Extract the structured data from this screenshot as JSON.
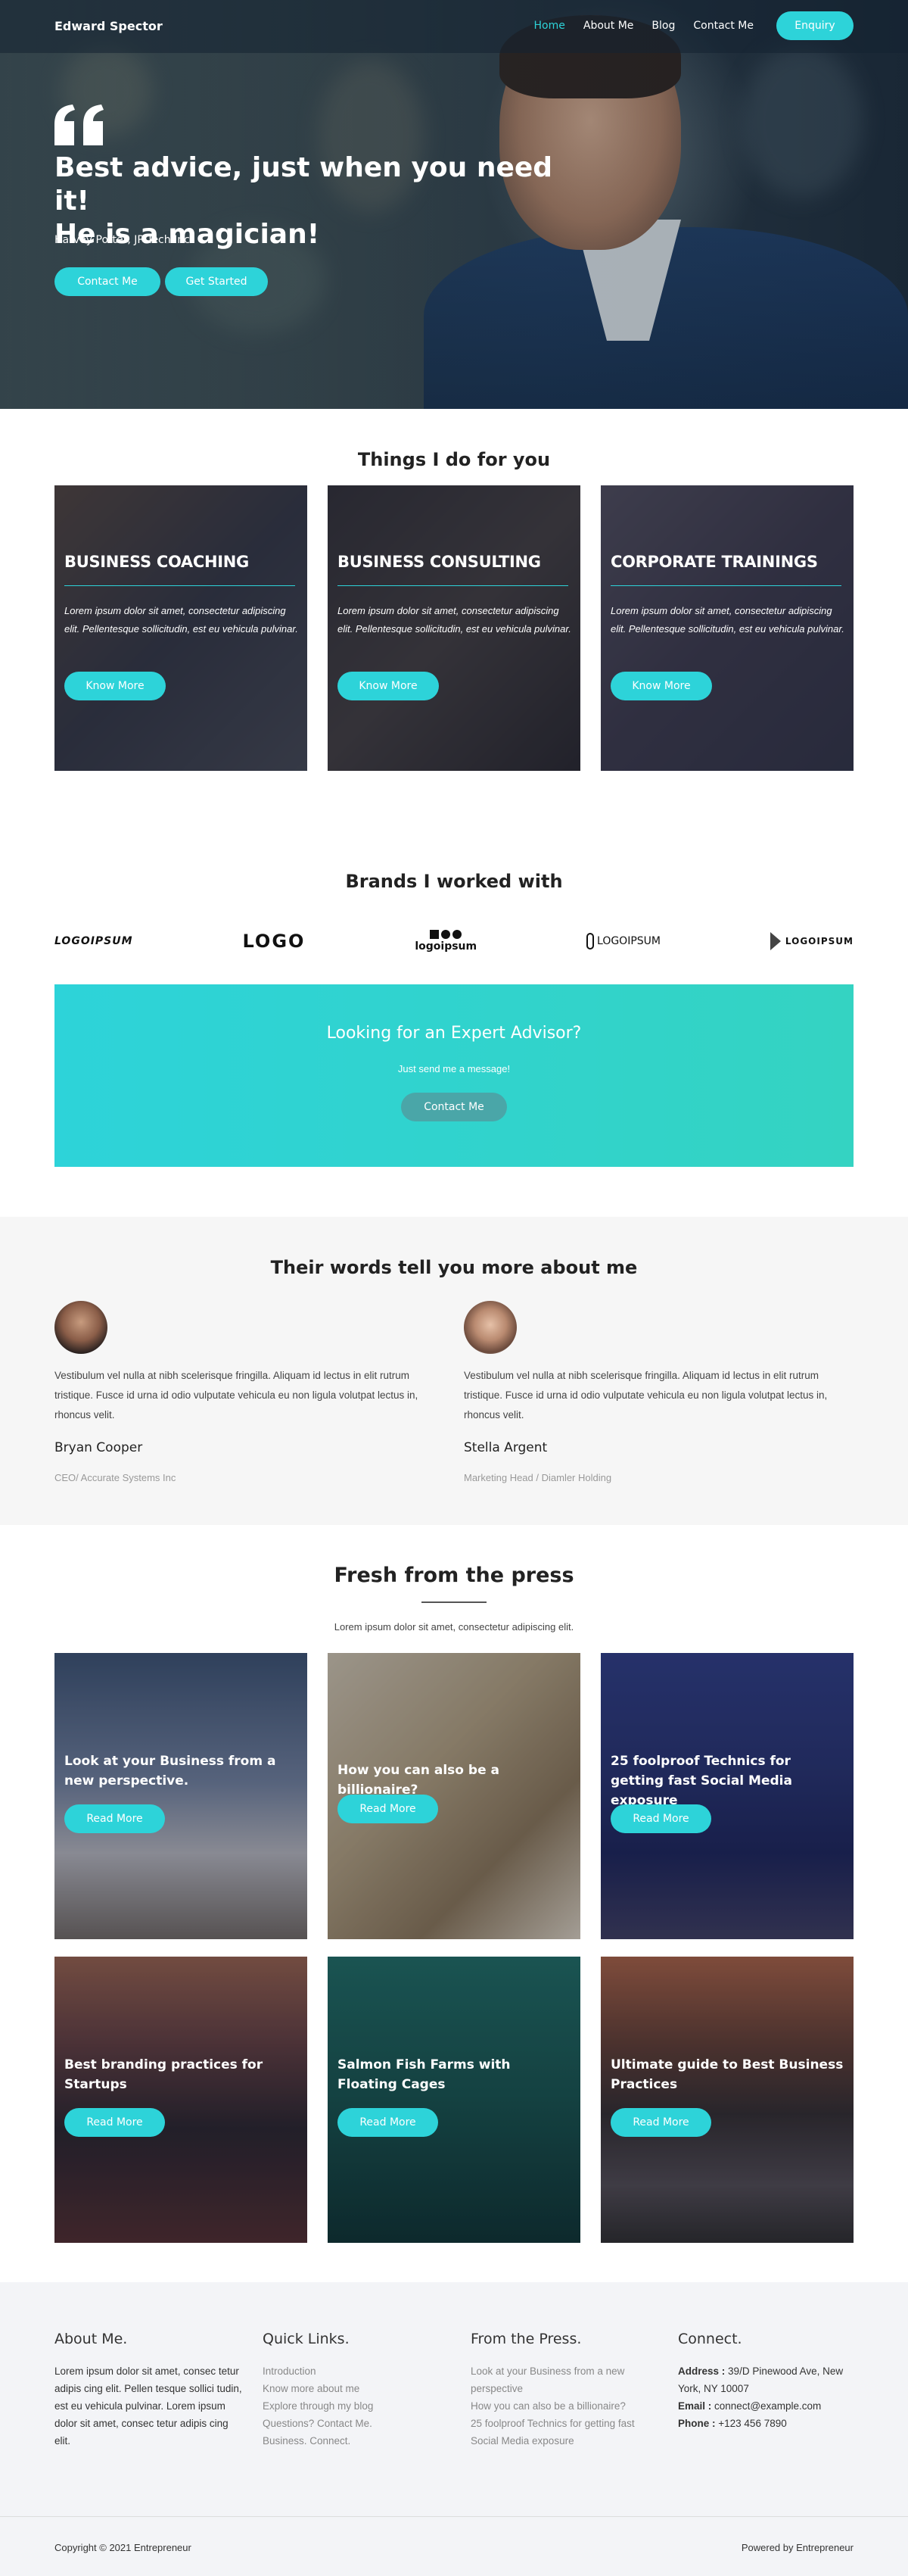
{
  "nav": {
    "brand": "Edward Spector",
    "items": [
      "Home",
      "About Me",
      "Blog",
      "Contact Me"
    ],
    "enquiry": "Enquiry"
  },
  "hero": {
    "title_line1": "Best advice, just when you need it!",
    "title_line2": "He is a magician!",
    "author": "Harvey Potter, JP Tech Inc",
    "btn_contact": "Contact Me",
    "btn_start": "Get Started"
  },
  "services": {
    "title": "Things I do for you",
    "items": [
      {
        "title": "BUSINESS COACHING",
        "text": "Lorem ipsum dolor sit amet, consectetur adipiscing elit. Pellentesque sollicitudin, est eu vehicula pulvinar.",
        "btn": "Know More"
      },
      {
        "title": "BUSINESS CONSULTING",
        "text": "Lorem ipsum dolor sit amet, consectetur adipiscing elit. Pellentesque sollicitudin, est eu vehicula pulvinar.",
        "btn": "Know More"
      },
      {
        "title": "CORPORATE TRAININGS",
        "text": "Lorem ipsum dolor sit amet, consectetur adipiscing elit. Pellentesque sollicitudin, est eu vehicula pulvinar.",
        "btn": "Know More"
      }
    ]
  },
  "brands": {
    "title": "Brands I worked with",
    "logos": [
      "LOGOIPSUM",
      "LOGO",
      "logoipsum",
      "LOGOIPSUM",
      "LOGOIPSUM"
    ]
  },
  "cta": {
    "title": "Looking for an Expert Advisor?",
    "subtitle": "Just send me a message!",
    "btn": "Contact Me",
    "colors": {
      "start": "#2dd3d9",
      "end": "#34d3c2"
    }
  },
  "testimonials": {
    "title": "Their words tell you more about me",
    "items": [
      {
        "text": "Vestibulum vel nulla at nibh scelerisque fringilla. Aliquam id lectus in elit rutrum tristique. Fusce id urna id odio vulputate vehicula eu non ligula volutpat lectus in, rhoncus velit.",
        "name": "Bryan Cooper",
        "role": "CEO/ Accurate Systems Inc"
      },
      {
        "text": "Vestibulum vel nulla at nibh scelerisque fringilla. Aliquam id lectus in elit rutrum tristique. Fusce id urna id odio vulputate vehicula eu non ligula volutpat lectus in, rhoncus velit.",
        "name": "Stella Argent",
        "role": "Marketing Head / Diamler Holding"
      }
    ]
  },
  "press": {
    "title": "Fresh from the press",
    "subtitle": "Lorem ipsum dolor sit amet, consectetur adipiscing elit.",
    "posts": [
      {
        "title": "Look at your Business from a new perspective.",
        "btn": "Read More"
      },
      {
        "title": "How you can also be a billionaire?",
        "btn": "Read More"
      },
      {
        "title": "25 foolproof Technics for getting fast Social Media exposure",
        "btn": "Read More"
      },
      {
        "title": "Best branding practices for Startups",
        "btn": "Read More"
      },
      {
        "title": "Salmon Fish Farms with Floating Cages",
        "btn": "Read More"
      },
      {
        "title": "Ultimate guide to Best Business Practices",
        "btn": "Read More"
      }
    ]
  },
  "footer": {
    "about_title": "About Me.",
    "about_text": "Lorem ipsum dolor sit amet, consec tetur adipis cing elit. Pellen tesque sollici tudin, est eu vehicula pulvinar. Lorem ipsum dolor sit amet, consec tetur adipis cing elit.",
    "links_title": "Quick Links.",
    "links": [
      "Introduction",
      "Know more about me",
      "Explore through my blog",
      "Questions? Contact Me.",
      "Business. Connect."
    ],
    "press_title": "From the Press.",
    "press_links": [
      "Look at your Business from a new perspective",
      "How you can also be a billionaire?",
      "25 foolproof Technics for getting fast Social Media exposure"
    ],
    "connect_title": "Connect.",
    "address_label": "Address :",
    "address": "39/D Pinewood Ave, New York, NY 10007",
    "email_label": "Email :",
    "email": "connect@example.com",
    "phone_label": "Phone :",
    "phone": "+123 456 7890",
    "copyright": "Copyright © 2021 Entrepreneur",
    "powered": "Powered by Entrepreneur"
  }
}
